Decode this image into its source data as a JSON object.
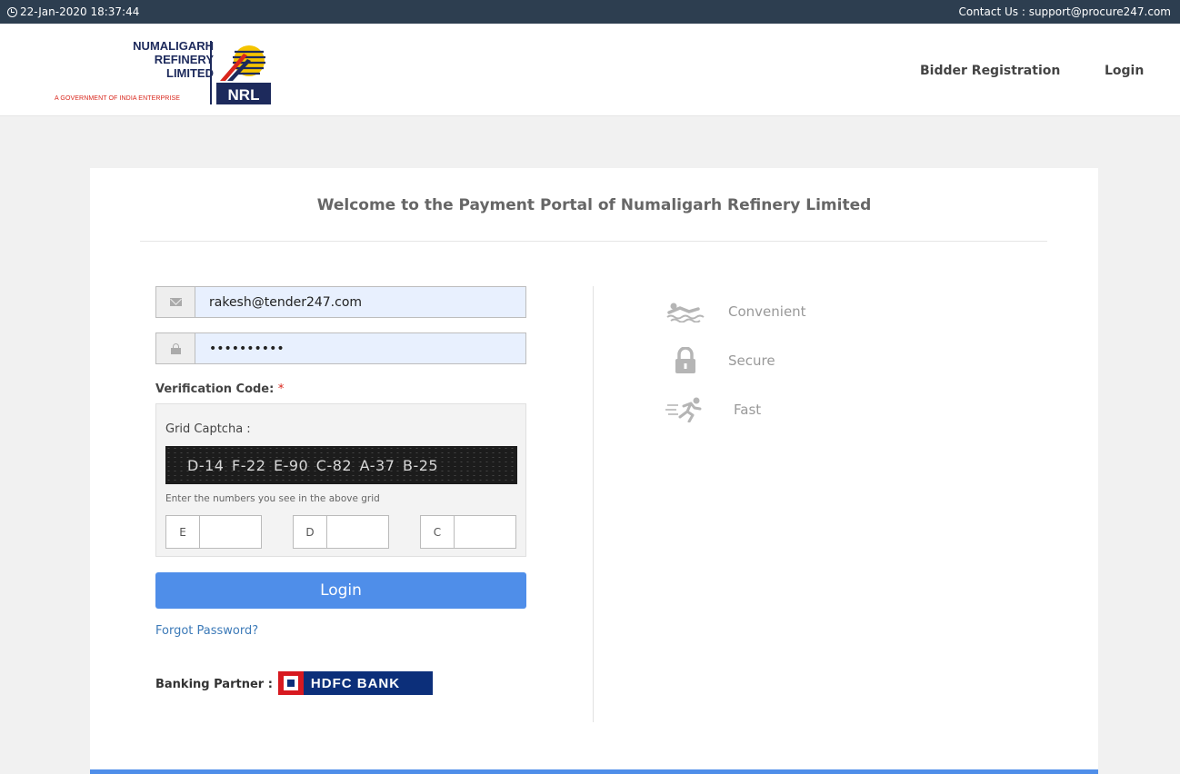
{
  "topbar": {
    "datetime": "22-Jan-2020 18:37:44",
    "contact": "Contact Us : support@procure247.com"
  },
  "logo": {
    "line1": "NUMALIGARH",
    "line2": "REFINERY",
    "line3": "LIMITED",
    "tagline": "A GOVERNMENT OF INDIA ENTERPRISE",
    "brand": "NRL"
  },
  "nav": {
    "bidder_registration": "Bidder Registration",
    "login": "Login"
  },
  "page": {
    "title": "Welcome to the Payment Portal of Numaligarh Refinery Limited"
  },
  "form": {
    "email_value": "rakesh@tender247.com",
    "password_value": "••••••••••",
    "verification_label": "Verification Code:",
    "required_mark": "*",
    "captcha_label": "Grid Captcha :",
    "captcha_text": "D-14 F-22 E-90 C-82 A-37 B-25",
    "captcha_hint": "Enter the numbers you see in the above grid",
    "cells": [
      "E",
      "D",
      "C"
    ],
    "login_button": "Login",
    "forgot_password": "Forgot Password?",
    "banking_partner_label": "Banking Partner :",
    "bank_name": "HDFC BANK"
  },
  "features": [
    {
      "label": "Convenient",
      "icon": "swimmer-icon"
    },
    {
      "label": "Secure",
      "icon": "lock-icon"
    },
    {
      "label": "Fast",
      "icon": "runner-icon"
    }
  ],
  "colors": {
    "topbar": "#2d3e50",
    "accent": "#4f8ee9",
    "brand_navy": "#1d2a5c",
    "brand_red": "#d9261c"
  }
}
